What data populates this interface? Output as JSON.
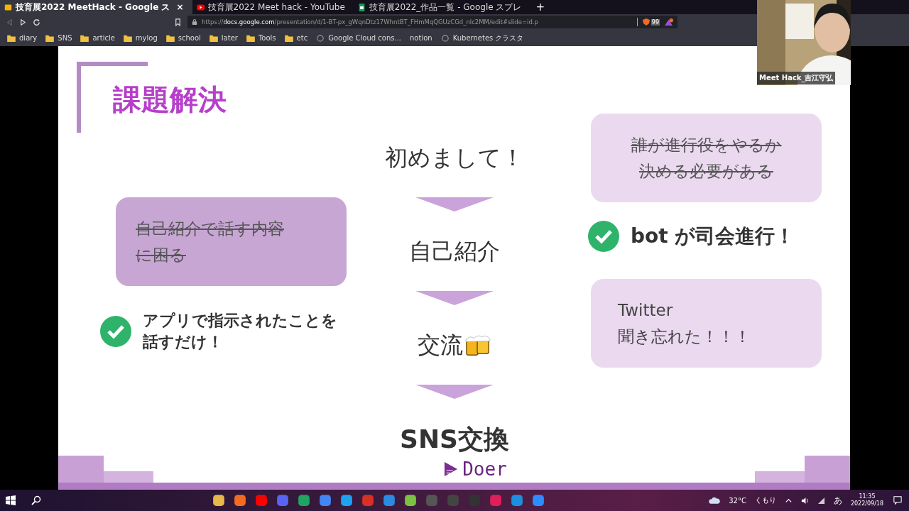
{
  "browser": {
    "tabs": [
      {
        "title": "技育展2022 MeetHack - Google ス",
        "kind": "slides",
        "selected": true
      },
      {
        "title": "技育展2022 Meet hack - YouTube",
        "kind": "youtube",
        "selected": false
      },
      {
        "title": "技育展2022_作品一覧 - Google スプレ",
        "kind": "sheets",
        "selected": false
      }
    ],
    "close_label": "×",
    "new_tab_label": "+",
    "url": "https://**docs.google.com**/presentation/d/1-BT-px_gWqnDtz17WhntBT_FHmMqQGUzCGd_nlc2MM/edit#slide=id.p",
    "shields_count": "99",
    "bookmarks": [
      {
        "label": "diary",
        "kind": "folder"
      },
      {
        "label": "SNS",
        "kind": "folder"
      },
      {
        "label": "article",
        "kind": "folder"
      },
      {
        "label": "mylog",
        "kind": "folder"
      },
      {
        "label": "school",
        "kind": "folder"
      },
      {
        "label": "later",
        "kind": "folder"
      },
      {
        "label": "Tools",
        "kind": "folder"
      },
      {
        "label": "etc",
        "kind": "folder"
      },
      {
        "label": "Google Cloud cons...",
        "kind": "site"
      },
      {
        "label": "notion",
        "kind": "plain"
      },
      {
        "label": "Kubernetes クラスタ",
        "kind": "site"
      }
    ]
  },
  "slide": {
    "title": "課題解決",
    "left_bubble": {
      "lines": [
        "自己紹介で話す内容",
        "に困る"
      ],
      "struck": true
    },
    "left_check": {
      "lines": [
        "アプリで指示されたことを",
        "話すだけ！"
      ]
    },
    "flow": [
      {
        "label": "初めまして！",
        "bold": false,
        "kind": "text"
      },
      {
        "label": "自己紹介",
        "bold": false,
        "kind": "text"
      },
      {
        "label": "交流",
        "bold": false,
        "kind": "beer"
      },
      {
        "label": "SNS交換",
        "bold": true,
        "kind": "text"
      }
    ],
    "right_bubble": {
      "lines": [
        "誰が進行役をやるか",
        "決める必要がある"
      ],
      "struck": true
    },
    "right_check": {
      "lines": [
        "bot が司会進行！"
      ]
    },
    "right_bubble_2": {
      "lines": [
        "Twitter",
        "聞き忘れた！！！"
      ],
      "struck": false
    },
    "logo": "Doer"
  },
  "webcam": {
    "name": "Meet Hack_吉江守弘"
  },
  "taskbar": {
    "temperature": "32°C",
    "weather": "くもり",
    "ime": "あ",
    "time": "11:35",
    "date": "2022/09/18"
  }
}
